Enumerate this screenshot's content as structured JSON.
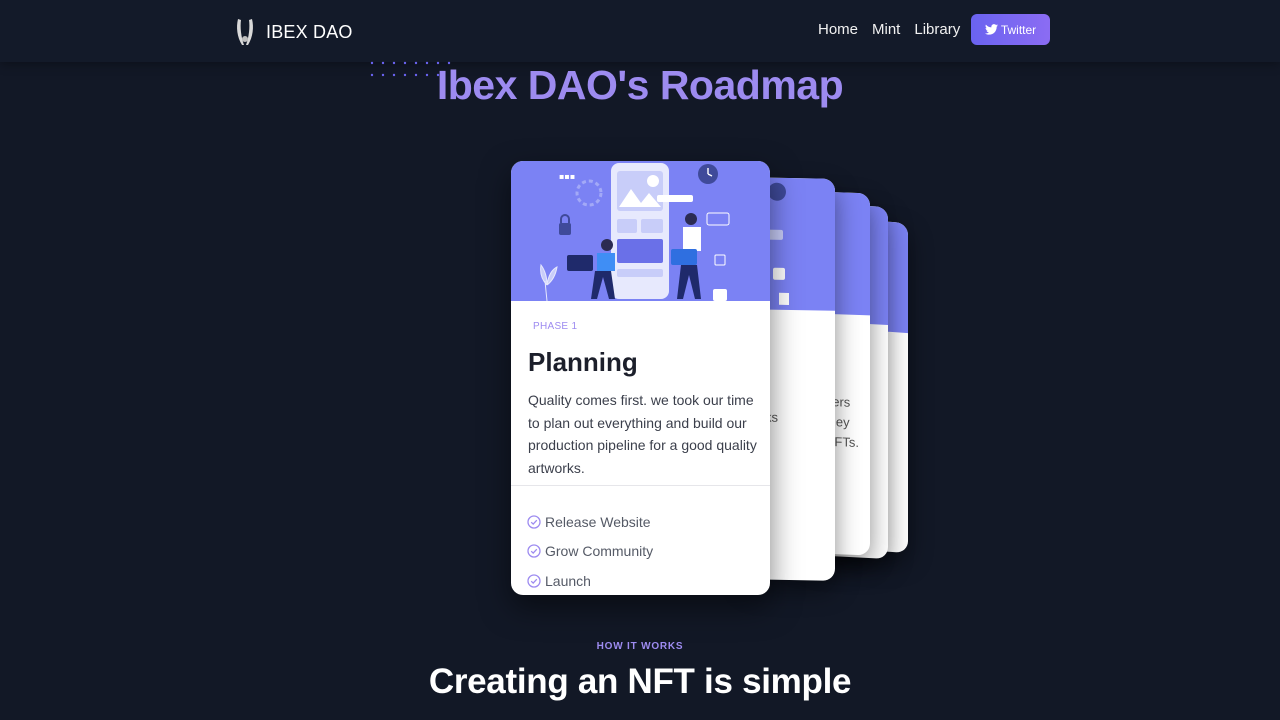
{
  "brand": {
    "name": "IBEX DAO",
    "logo_icon": "ibex-horns-icon"
  },
  "nav": {
    "links": [
      "Home",
      "Mint",
      "Library"
    ],
    "twitter_label": "Twitter",
    "twitter_icon": "twitter-bird-icon"
  },
  "roadmap": {
    "title": "Ibex DAO's Roadmap",
    "card": {
      "phase": "PHASE 1",
      "title": "Planning",
      "description": "Quality comes first. we took our time to plan out everything and build our production pipeline for a good quality artworks.",
      "tasks": [
        "Release Website",
        "Grow Community",
        "Launch"
      ]
    },
    "peek_card_2": {
      "lines": [
        "ks"
      ]
    },
    "peek_card_3": {
      "lines": [
        "bers",
        "they",
        "NFTs."
      ]
    }
  },
  "how_it_works": {
    "label": "HOW IT WORKS",
    "title": "Creating an NFT is simple"
  },
  "colors": {
    "background": "#121826",
    "accent": "#9d8bf0",
    "card_header": "#7b82f4",
    "button_gradient_start": "#6a63f0",
    "button_gradient_end": "#8b6cf3"
  }
}
